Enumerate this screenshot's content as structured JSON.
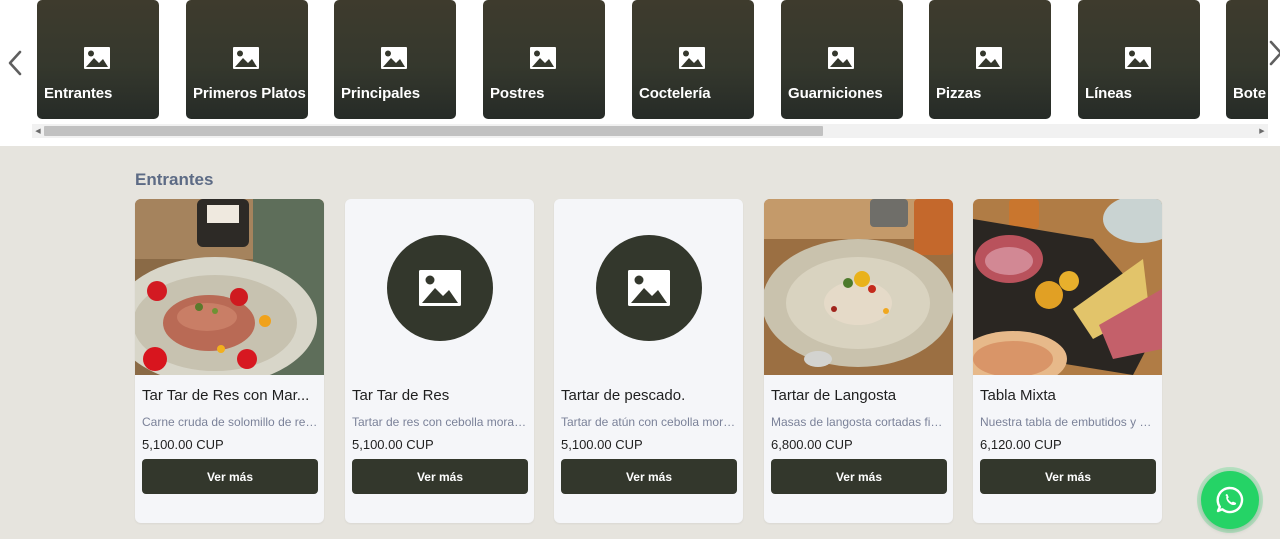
{
  "categories": {
    "items": [
      {
        "label": "Entrantes",
        "icon": "image-icon"
      },
      {
        "label": "Primeros Platos",
        "icon": "image-icon"
      },
      {
        "label": "Principales",
        "icon": "image-icon"
      },
      {
        "label": "Postres",
        "icon": "image-icon"
      },
      {
        "label": "Coctelería",
        "icon": "image-icon"
      },
      {
        "label": "Guarniciones",
        "icon": "image-icon"
      },
      {
        "label": "Pizzas",
        "icon": "image-icon"
      },
      {
        "label": "Líneas",
        "icon": "image-icon"
      },
      {
        "label": "Bote",
        "icon": "image-icon"
      }
    ],
    "scroll_position": 0.64
  },
  "section": {
    "title": "Entrantes"
  },
  "products": [
    {
      "name": "Tar Tar de Res con Mar...",
      "description": "Carne cruda de solomillo de res...",
      "price": "5,100.00 CUP",
      "button_label": "Ver más",
      "image": "photo"
    },
    {
      "name": "Tar Tar de Res",
      "description": "Tartar de res con cebolla morad...",
      "price": "5,100.00 CUP",
      "button_label": "Ver más",
      "image": "placeholder"
    },
    {
      "name": "Tartar de pescado.",
      "description": "Tartar de atún con cebolla mora...",
      "price": "5,100.00 CUP",
      "button_label": "Ver más",
      "image": "placeholder"
    },
    {
      "name": "Tartar de Langosta",
      "description": "Masas de langosta cortadas fin...",
      "price": "6,800.00 CUP",
      "button_label": "Ver más",
      "image": "photo"
    },
    {
      "name": "Tabla Mixta",
      "description": "Nuestra tabla de embutidos y q...",
      "price": "6,120.00 CUP",
      "button_label": "Ver más",
      "image": "photo"
    }
  ],
  "colors": {
    "tile_dark": "#33372c",
    "section_title": "#5d6b85",
    "whatsapp": "#25d366",
    "description": "#7b8299"
  },
  "icons": {
    "prev": "chevron-left-icon",
    "next": "chevron-right-icon",
    "placeholder": "image-icon",
    "chat": "whatsapp-icon"
  }
}
